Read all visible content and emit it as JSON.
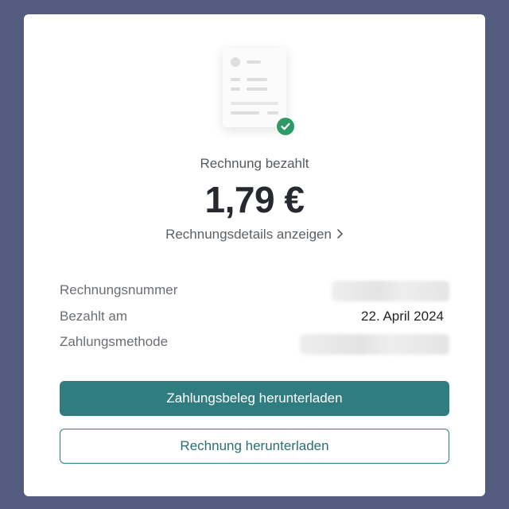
{
  "invoice": {
    "status": "Rechnung bezahlt",
    "amount": "1,79 €",
    "details_link": "Rechnungsdetails anzeigen",
    "chevron_icon": "chevron-right-icon",
    "check_icon": "check-circle-icon",
    "colors": {
      "background": "#545c7f",
      "accent": "#2f7d80",
      "success": "#2e9a68"
    }
  },
  "info_rows": [
    {
      "label": "Rechnungsnummer",
      "value": ""
    },
    {
      "label": "Bezahlt am",
      "value": "22. April 2024"
    },
    {
      "label": "Zahlungsmethode",
      "value": ""
    }
  ],
  "buttons": {
    "download_receipt": "Zahlungsbeleg herunterladen",
    "download_invoice": "Rechnung herunterladen"
  }
}
